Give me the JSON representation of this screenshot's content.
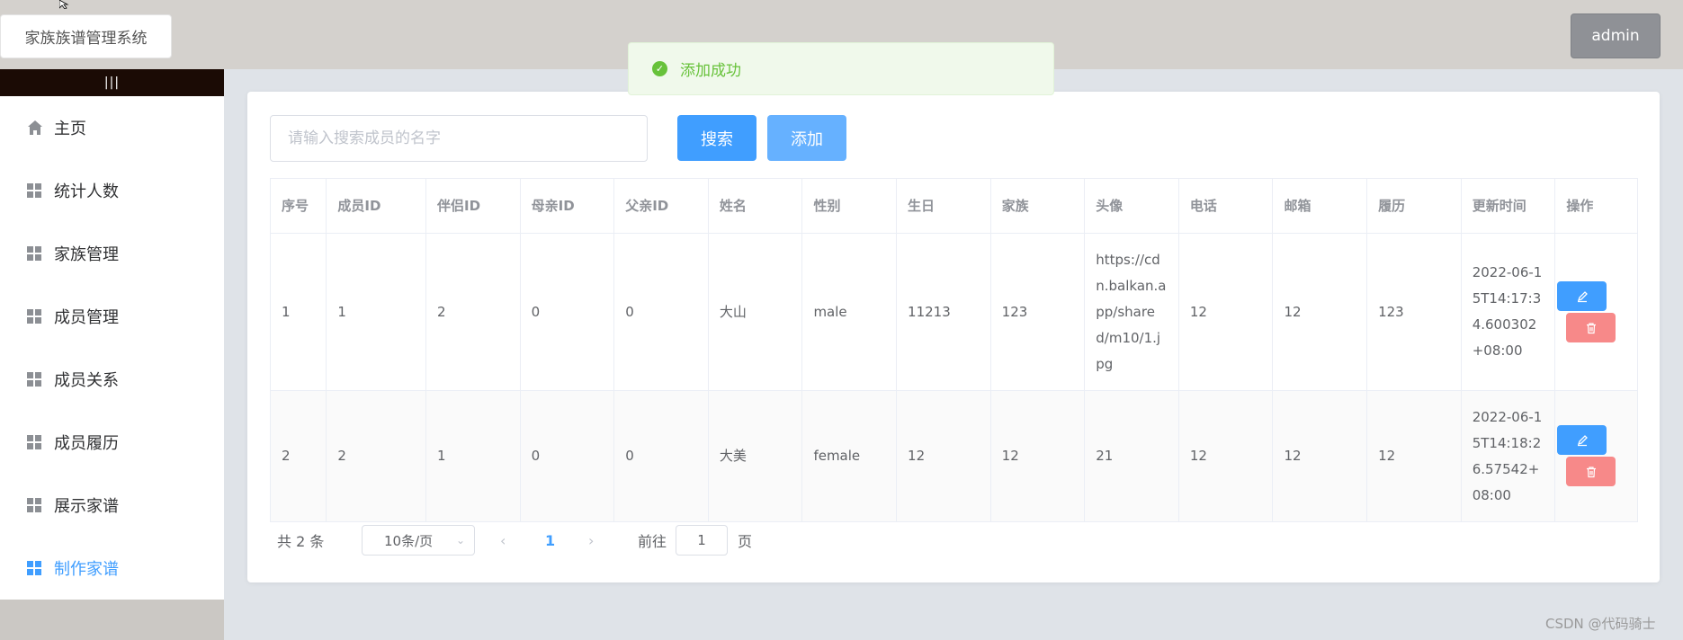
{
  "header": {
    "brand": "家族族谱管理系统",
    "user_button": "admin"
  },
  "sidebar": {
    "collapse_label": "|||",
    "items": [
      {
        "label": "主页",
        "icon": "home-icon"
      },
      {
        "label": "统计人数",
        "icon": "grid-icon"
      },
      {
        "label": "家族管理",
        "icon": "grid-icon"
      },
      {
        "label": "成员管理",
        "icon": "grid-icon"
      },
      {
        "label": "成员关系",
        "icon": "grid-icon"
      },
      {
        "label": "成员履历",
        "icon": "grid-icon"
      },
      {
        "label": "展示家谱",
        "icon": "grid-icon"
      },
      {
        "label": "制作家谱",
        "icon": "grid-icon",
        "active": true
      }
    ]
  },
  "toolbar": {
    "search_placeholder": "请输入搜索成员的名字",
    "search_value": "",
    "search_label": "搜索",
    "add_label": "添加"
  },
  "table": {
    "columns": [
      "序号",
      "成员ID",
      "伴侣ID",
      "母亲ID",
      "父亲ID",
      "姓名",
      "性别",
      "生日",
      "家族",
      "头像",
      "电话",
      "邮箱",
      "履历",
      "更新时间",
      "操作"
    ],
    "rows": [
      [
        "1",
        "1",
        "2",
        "0",
        "0",
        "大山",
        "male",
        "11213",
        "123",
        "https://cdn.balkan.app/shared/m10/1.jpg",
        "12",
        "12",
        "123",
        "2022-06-15T14:17:34.600302+08:00"
      ],
      [
        "2",
        "2",
        "1",
        "0",
        "0",
        "大美",
        "female",
        "12",
        "12",
        "21",
        "12",
        "12",
        "12",
        "2022-06-15T14:18:26.57542+08:00"
      ]
    ]
  },
  "pagination": {
    "total": "共 2 条",
    "page_size": "10条/页",
    "current_page": "1",
    "goto_label": "前往",
    "goto_value": "1",
    "page_unit": "页"
  },
  "toast": {
    "message": "添加成功",
    "color": "#67c23a"
  },
  "watermark": "CSDN @代码骑士",
  "colors": {
    "primary": "#409eff",
    "danger": "#f78989",
    "success": "#67c23a"
  }
}
